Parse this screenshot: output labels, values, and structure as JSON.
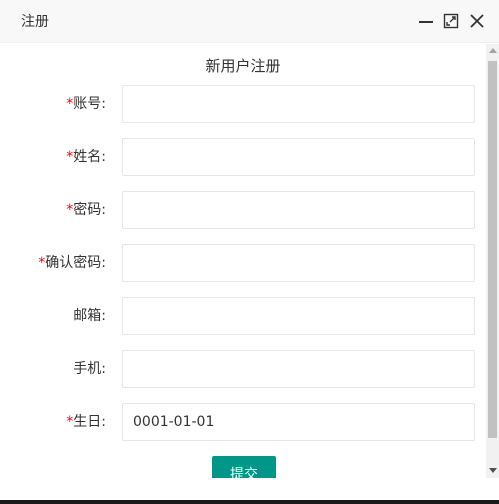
{
  "window": {
    "title": "注册"
  },
  "form": {
    "heading": "新用户注册",
    "required_mark": "*",
    "fields": [
      {
        "label": "账号:",
        "required": true,
        "value": "",
        "placeholder": ""
      },
      {
        "label": "姓名:",
        "required": true,
        "value": "",
        "placeholder": ""
      },
      {
        "label": "密码:",
        "required": true,
        "value": "",
        "placeholder": ""
      },
      {
        "label": "确认密码:",
        "required": true,
        "value": "",
        "placeholder": ""
      },
      {
        "label": "邮箱:",
        "required": false,
        "value": "",
        "placeholder": ""
      },
      {
        "label": "手机:",
        "required": false,
        "value": "",
        "placeholder": ""
      },
      {
        "label": "生日:",
        "required": true,
        "value": "0001-01-01",
        "placeholder": ""
      }
    ],
    "submit_label": "提交"
  },
  "colors": {
    "accent": "#009688",
    "required": "#ff0000",
    "titlebar_bg": "#f8f8f8",
    "input_border": "#e6e6e6"
  },
  "icons": {
    "minimize": "minimize-icon",
    "maximize": "maximize-icon",
    "close": "close-icon"
  }
}
